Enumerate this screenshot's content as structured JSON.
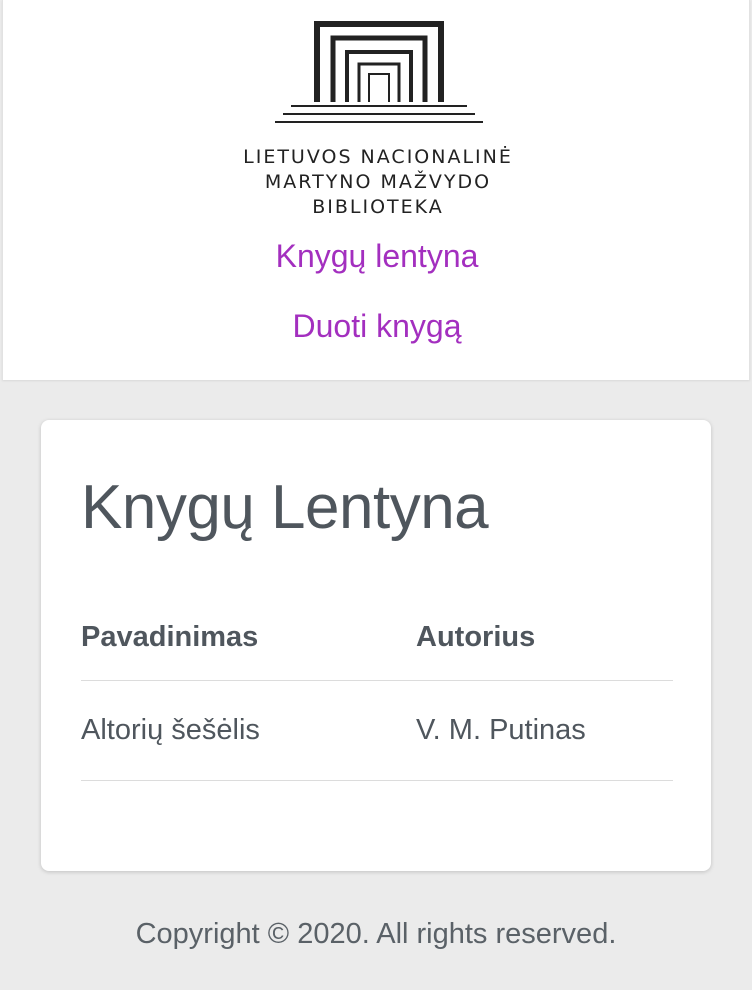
{
  "header": {
    "logo": {
      "line1": "LIETUVOS NACIONALINĖ",
      "line2": "MARTYNO MAŽVYDO",
      "line3": "BIBLIOTEKA",
      "icon": "library-building-logo-icon"
    },
    "nav": [
      {
        "label": "Knygų lentyna"
      },
      {
        "label": "Duoti knygą"
      }
    ]
  },
  "main": {
    "title": "Knygų Lentyna",
    "table": {
      "columns": [
        "Pavadinimas",
        "Autorius"
      ],
      "rows": [
        [
          "Altorių šešėlis",
          "V. M. Putinas"
        ]
      ]
    }
  },
  "footer": {
    "copyright": "Copyright © 2020. All rights reserved."
  },
  "colors": {
    "link": "#a32fbf",
    "text": "#4f565d",
    "background": "#ebebeb",
    "card": "#ffffff"
  }
}
